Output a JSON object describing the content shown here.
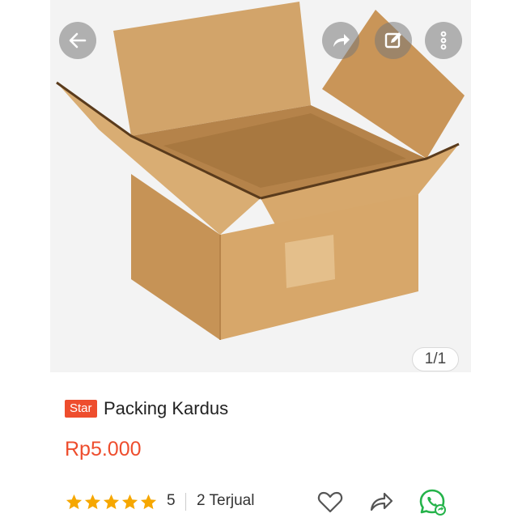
{
  "gallery": {
    "image_alt": "cardboard-box-photo",
    "counter": "1/1"
  },
  "top_actions": {
    "back_icon": "arrow-left-icon",
    "share_icon": "share-icon",
    "edit_icon": "edit-icon",
    "more_icon": "more-vertical-icon"
  },
  "product": {
    "badge": "Star",
    "name": "Packing Kardus",
    "price": "Rp5.000",
    "rating": "5",
    "rating_stars": 5,
    "sold": "2 Terjual"
  },
  "bottom_actions": {
    "like_icon": "heart-icon",
    "share_icon": "share-icon",
    "whatsapp_icon": "whatsapp-icon"
  },
  "colors": {
    "accent": "#ee4d2d",
    "star": "#f6a700",
    "whatsapp": "#25b34a"
  }
}
